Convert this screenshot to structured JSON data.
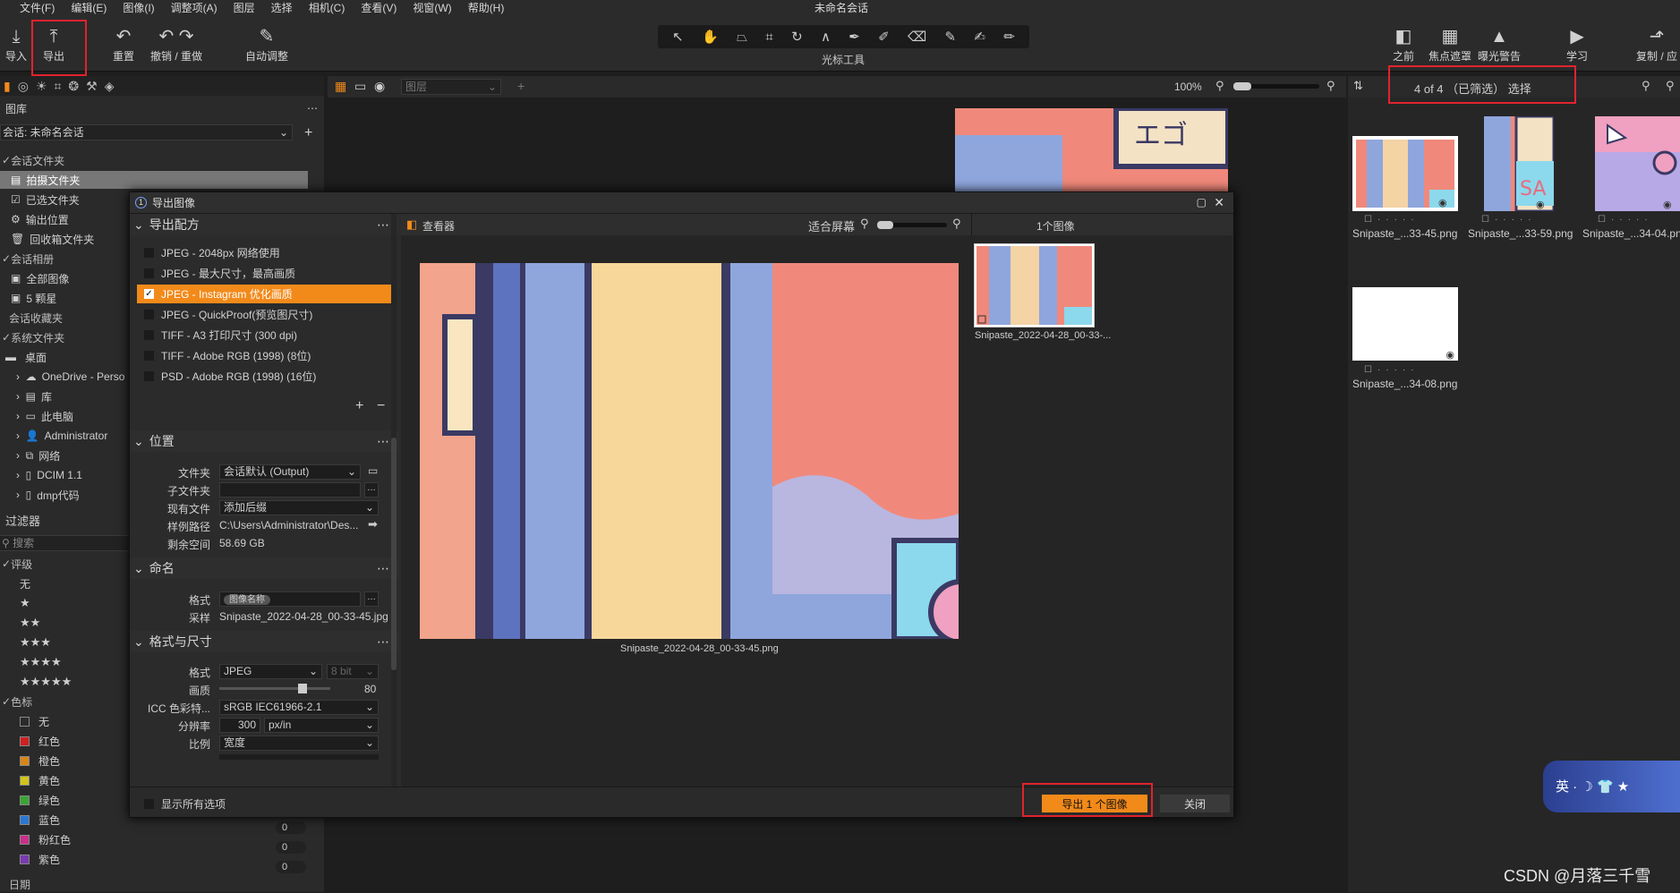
{
  "menu": {
    "items": [
      "文件(F)",
      "编辑(E)",
      "图像(I)",
      "调整项(A)",
      "图层",
      "选择",
      "相机(C)",
      "查看(V)",
      "视窗(W)",
      "帮助(H)"
    ],
    "title": "未命名会话"
  },
  "toolbar": {
    "import": "导入",
    "export": "导出",
    "reset": "重置",
    "undo_redo": "撤销 / 重做",
    "auto_adjust": "自动调整",
    "cursor_tools": "光标工具",
    "before": "之前",
    "focus_mask": "焦点遮罩",
    "exposure_warning": "曝光警告",
    "learn": "学习",
    "copy_apply": "复制 / 应"
  },
  "left": {
    "library": "图库",
    "session": "会话: 未命名会话",
    "session_folders": "会话文件夹",
    "capture_folder": "拍摄文件夹",
    "selects_folder": "已选文件夹",
    "output_location": "输出位置",
    "trash_folder": "回收箱文件夹",
    "session_albums": "会话相册",
    "all_images": "全部图像",
    "five_stars": "5 颗星",
    "session_favorites": "会话收藏夹",
    "system_folders": "系统文件夹",
    "desktop": "桌面",
    "tree": [
      "OneDrive - Perso",
      "库",
      "此电脑",
      "Administrator",
      "网络",
      "DCIM 1.1",
      "dmp代码"
    ],
    "filters": "过滤器",
    "search_placeholder": "搜索",
    "rating": "评级",
    "rating_none": "无",
    "stars": [
      "★",
      "★★",
      "★★★",
      "★★★★",
      "★★★★★"
    ],
    "color_tag": "色标",
    "colors": [
      {
        "name": "无",
        "hex": "#2a2a2a"
      },
      {
        "name": "红色",
        "hex": "#d12020"
      },
      {
        "name": "橙色",
        "hex": "#d8861a"
      },
      {
        "name": "黄色",
        "hex": "#d3c41c"
      },
      {
        "name": "绿色",
        "hex": "#3aa536"
      },
      {
        "name": "蓝色",
        "hex": "#2a78d0"
      },
      {
        "name": "粉红色",
        "hex": "#c8308a"
      },
      {
        "name": "紫色",
        "hex": "#7a3ab0"
      }
    ],
    "counts": [
      "0",
      "0",
      "0"
    ],
    "date": "日期"
  },
  "center": {
    "layer": "图层",
    "zoom": "100%"
  },
  "browser": {
    "count": "4 of 4  （已筛选）  选择",
    "thumbs": [
      "Snipaste_...33-45.png",
      "Snipaste_...33-59.png",
      "Snipaste_...34-04.pn",
      "Snipaste_...34-08.png"
    ]
  },
  "dialog": {
    "title": "导出图像",
    "recipes_header": "导出配方",
    "recipes": [
      "JPEG - 2048px 网络使用",
      "JPEG - 最大尺寸，最高画质",
      "JPEG - Instagram 优化画质",
      "JPEG - QuickProof(预览图尺寸)",
      "TIFF - A3 打印尺寸 (300 dpi)",
      "TIFF - Adobe RGB (1998) (8位)",
      "PSD - Adobe RGB (1998) (16位)"
    ],
    "location_header": "位置",
    "folder_label": "文件夹",
    "folder_value": "会话默认 (Output)",
    "subfolder_label": "子文件夹",
    "existing_label": "现有文件",
    "existing_value": "添加后缀",
    "sample_path_label": "样例路径",
    "sample_path_value": "C:\\Users\\Administrator\\Des...",
    "free_space_label": "剩余空间",
    "free_space_value": "58.69 GB",
    "naming_header": "命名",
    "format_label": "格式",
    "format_token": "图像名称",
    "sample_label": "采样",
    "sample_value": "Snipaste_2022-04-28_00-33-45.jpg",
    "fmt_header": "格式与尺寸",
    "fmt_label": "格式",
    "fmt_value": "JPEG",
    "bit_value": "8 bit",
    "quality_label": "画质",
    "quality_value": "80",
    "icc_label": "ICC 色彩特...",
    "icc_value": "sRGB IEC61966-2.1",
    "res_label": "分辨率",
    "res_value": "300",
    "res_unit": "px/in",
    "scale_label": "比例",
    "scale_value": "宽度",
    "viewer_label": "查看器",
    "fit_label": "适合屏幕",
    "image_count": "1个图像",
    "preview_filename": "Snipaste_2022-04-28_00-33-45.png",
    "thumb_filename": "Snipaste_2022-04-28_00-33-...",
    "show_all": "显示所有选项",
    "export_button": "导出 1 个图像",
    "close_button": "关闭"
  },
  "watermark": "CSDN @月落三千雪",
  "ime": "英 · ☽ 👕 ★"
}
